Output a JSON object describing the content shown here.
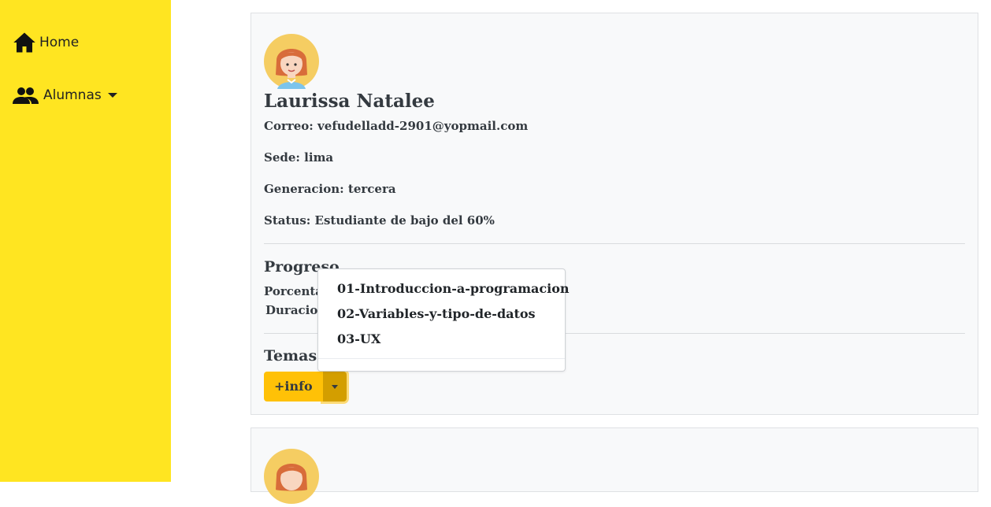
{
  "sidebar": {
    "items": [
      {
        "label": "Home",
        "icon": "home-icon"
      },
      {
        "label": "Alumnas",
        "icon": "people-icon",
        "has_dropdown": true
      }
    ]
  },
  "student": {
    "name": "Laurissa Natalee",
    "correo": "Correo: vefudelladd-2901@yopmail.com",
    "sede": "Sede: lima",
    "generacion": "Generacion: tercera",
    "status": "Status: Estudiante de bajo del 60%"
  },
  "progreso": {
    "title": "Progreso",
    "porcentaje_label": "Porcenta",
    "duracion_label": "Duracion"
  },
  "temas": {
    "title": "Temas",
    "button_label": "+info",
    "dropdown_items": [
      "01-Introduccion-a-programacion",
      "02-Variables-y-tipo-de-datos",
      "03-UX"
    ]
  },
  "colors": {
    "sidebar_bg": "#ffe521",
    "card_bg": "#f8f9fa",
    "button_warning": "#ffc107",
    "button_toggle": "#d39e00"
  }
}
